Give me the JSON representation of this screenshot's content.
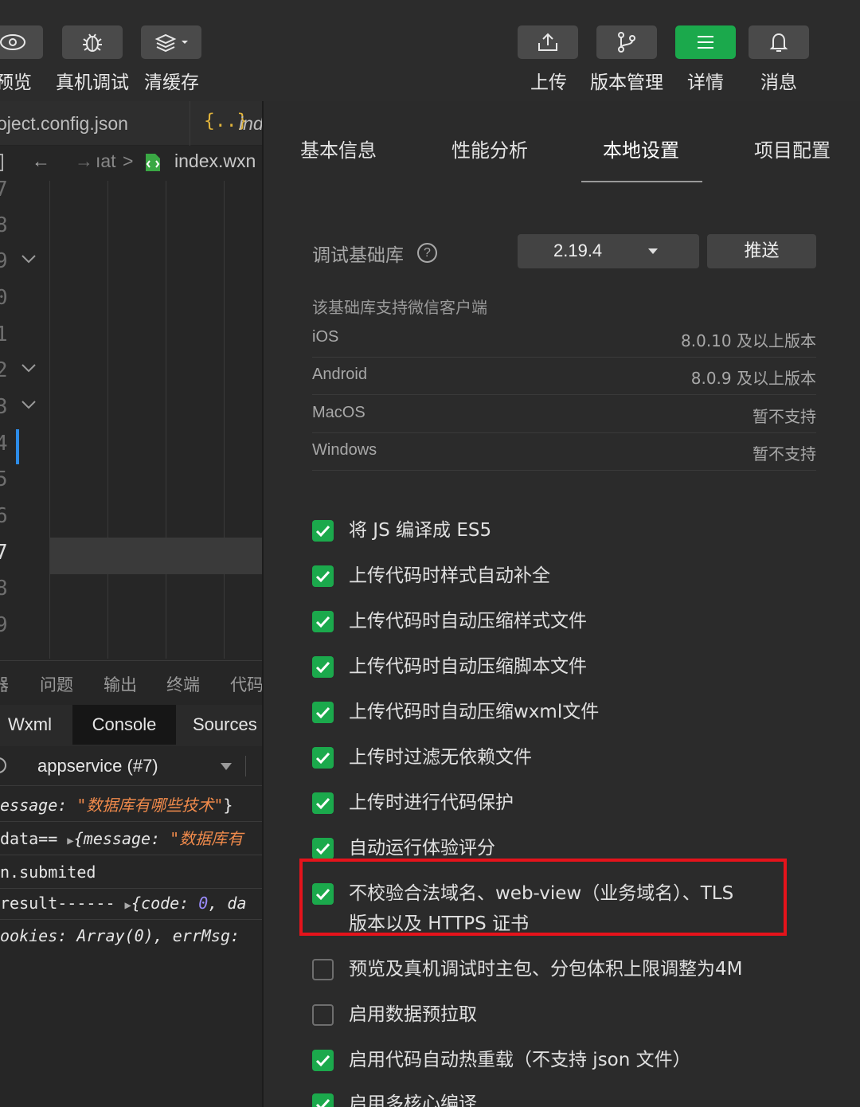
{
  "toolbar": {
    "left_buttons": [
      {
        "label": "预览",
        "icon": "eye-icon"
      },
      {
        "label": "真机调试",
        "icon": "bug-icon"
      },
      {
        "label": "清缓存",
        "icon": "layers-icon"
      }
    ],
    "right_buttons": [
      {
        "label": "上传",
        "icon": "upload-icon"
      },
      {
        "label": "版本管理",
        "icon": "branch-icon"
      },
      {
        "label": "详情",
        "icon": "menu-icon",
        "active": true
      },
      {
        "label": "消息",
        "icon": "bell-icon"
      }
    ]
  },
  "editor": {
    "file_tabs": [
      "oject.config.json",
      "ind"
    ],
    "breadcrumb": {
      "parent": "ıat",
      "separator": ">",
      "file": "index.wxn"
    },
    "gutter_lines": [
      "7",
      "8",
      "9",
      "0",
      "1",
      "2",
      "3",
      "4",
      "5",
      "6",
      "7",
      "8",
      "9"
    ]
  },
  "bottom_panel": {
    "tabs": [
      "器",
      "问题",
      "输出",
      "终端",
      "代码"
    ],
    "devtools_tabs": [
      "Wxml",
      "Console",
      "Sources"
    ],
    "active_devtools_tab": "Console",
    "context_select": "appservice (#7)",
    "console_lines": [
      {
        "prefix": "essage: ",
        "string": "\"数据库有哪些技术\"",
        "suffix": "}"
      },
      {
        "prefix": "data== ",
        "obj_open": "{message: ",
        "string": "\"数据库有"
      },
      {
        "text": "n.submited"
      },
      {
        "prefix": " result------ ",
        "obj_open": "{code: ",
        "number": "0",
        "suffix": ", da"
      },
      {
        "text": "ookies: Array(0), errMsg:"
      }
    ]
  },
  "settings": {
    "tabs": [
      "基本信息",
      "性能分析",
      "本地设置",
      "项目配置"
    ],
    "active_tab": "本地设置",
    "debug_lib": {
      "label": "调试基础库",
      "help": "?",
      "version": "2.19.4",
      "push_label": "推送"
    },
    "support_title": "该基础库支持微信客户端",
    "platforms": [
      {
        "name": "iOS",
        "version": "8.0.10 及以上版本"
      },
      {
        "name": "Android",
        "version": "8.0.9 及以上版本"
      },
      {
        "name": "MacOS",
        "version": "暂不支持"
      },
      {
        "name": "Windows",
        "version": "暂不支持"
      }
    ],
    "options": [
      {
        "label": "将 JS 编译成 ES5",
        "checked": true
      },
      {
        "label": "上传代码时样式自动补全",
        "checked": true
      },
      {
        "label": "上传代码时自动压缩样式文件",
        "checked": true
      },
      {
        "label": "上传代码时自动压缩脚本文件",
        "checked": true
      },
      {
        "label": "上传代码时自动压缩wxml文件",
        "checked": true
      },
      {
        "label": "上传时过滤无依赖文件",
        "checked": true
      },
      {
        "label": "上传时进行代码保护",
        "checked": true
      },
      {
        "label": "自动运行体验评分",
        "checked": true
      },
      {
        "label": "不校验合法域名、web-view（业务域名）、TLS",
        "label2": "版本以及 HTTPS 证书",
        "checked": true,
        "highlighted": true
      },
      {
        "label": "预览及真机调试时主包、分包体积上限调整为4M",
        "checked": false
      },
      {
        "label": "启用数据预拉取",
        "checked": false
      },
      {
        "label": "启用代码自动热重载（不支持 json 文件）",
        "checked": true
      },
      {
        "label": "启用多核心编译",
        "checked": true
      }
    ]
  },
  "colors": {
    "accent_green": "#1ba94c",
    "highlight_red": "#e5131b",
    "string_orange": "#f08a4b",
    "number_purple": "#9b8cff"
  }
}
